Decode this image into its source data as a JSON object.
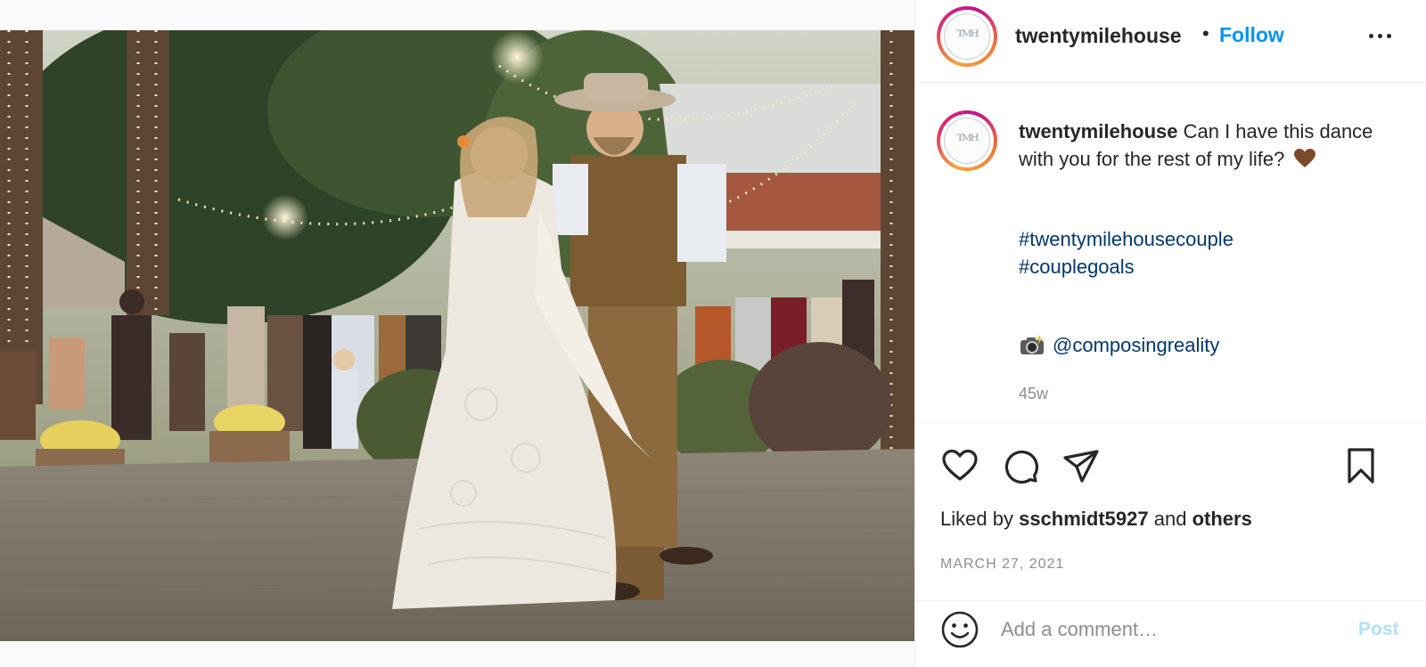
{
  "post": {
    "username": "twentymilehouse",
    "separator": "•",
    "follow_label": "Follow",
    "avatar_monogram": "TMH",
    "caption": {
      "username": "twentymilehouse",
      "text": "Can I have this dance with you for the rest of my life?",
      "emoji": "brown-heart",
      "hashtags": [
        "#twentymilehousecouple",
        "#couplegoals"
      ],
      "credit_emoji": "camera-with-flash",
      "credit_handle": "@composingreality"
    },
    "time_ago": "45w",
    "likes": {
      "prefix": "Liked by",
      "user": "sschmidt5927",
      "conj": "and",
      "others": "others"
    },
    "date": "MARCH 27, 2021"
  },
  "comment": {
    "placeholder": "Add a comment…",
    "post_label": "Post"
  },
  "icons": {
    "more": "more-options-icon",
    "like": "heart-icon",
    "comment": "comment-bubble-icon",
    "share": "paper-plane-icon",
    "save": "bookmark-icon",
    "emoji": "smiley-face-icon"
  },
  "colors": {
    "follow": "#0095f6",
    "link": "#00376b",
    "muted": "#8e8e8e",
    "post_disabled": "#b2dffc"
  }
}
